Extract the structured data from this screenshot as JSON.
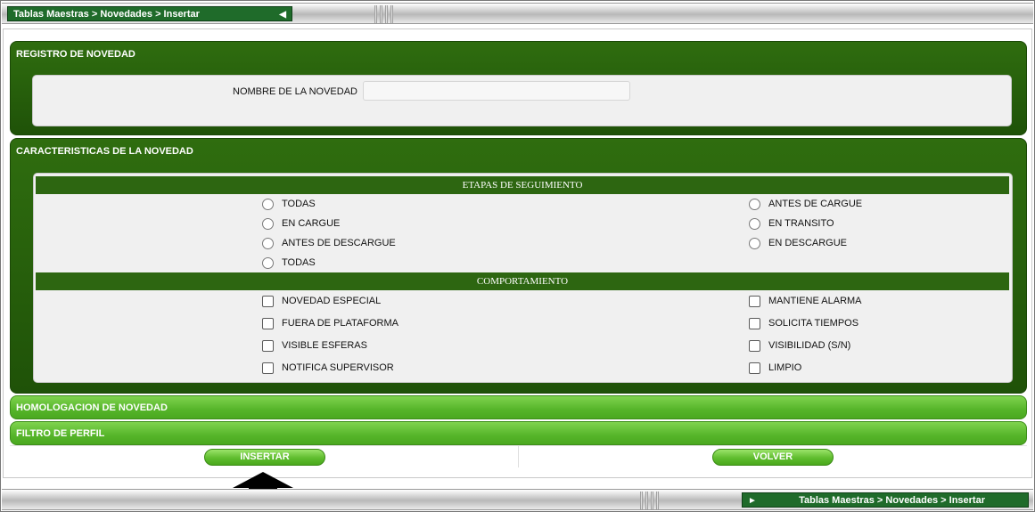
{
  "header": {
    "breadcrumb": "Tablas Maestras > Novedades > Insertar",
    "collapse_icon": "triangle-left-icon"
  },
  "footer": {
    "breadcrumb": "Tablas Maestras > Novedades > Insertar",
    "expand_icon": "triangle-right-icon"
  },
  "registro": {
    "title": "REGISTRO DE NOVEDAD",
    "nombre_label": "NOMBRE DE LA NOVEDAD",
    "nombre_value": "",
    "nombre_placeholder": ""
  },
  "caracteristicas": {
    "title": "CARACTERISTICAS DE LA NOVEDAD",
    "etapas_title": "ETAPAS DE SEGUIMIENTO",
    "etapas_left": [
      "TODAS",
      "EN CARGUE",
      "ANTES DE DESCARGUE",
      "TODAS"
    ],
    "etapas_right": [
      "ANTES DE CARGUE",
      "EN TRANSITO",
      "EN DESCARGUE"
    ],
    "comportamiento_title": "COMPORTAMIENTO",
    "comportamiento_left": [
      "NOVEDAD ESPECIAL",
      "FUERA DE PLATAFORMA",
      "VISIBLE ESFERAS",
      "NOTIFICA SUPERVISOR"
    ],
    "comportamiento_right": [
      "MANTIENE ALARMA",
      "SOLICITA TIEMPOS",
      "VISIBILIDAD (S/N)",
      "LIMPIO"
    ]
  },
  "homologacion": {
    "title": "HOMOLOGACION DE NOVEDAD"
  },
  "filtro": {
    "title": "FILTRO DE PERFIL"
  },
  "actions": {
    "insertar": "INSERTAR",
    "volver": "VOLVER"
  },
  "colors": {
    "dark_green": "#2f6d0f",
    "light_green": "#5fbd2e",
    "breadcrumb_green": "#1f6b2a"
  }
}
